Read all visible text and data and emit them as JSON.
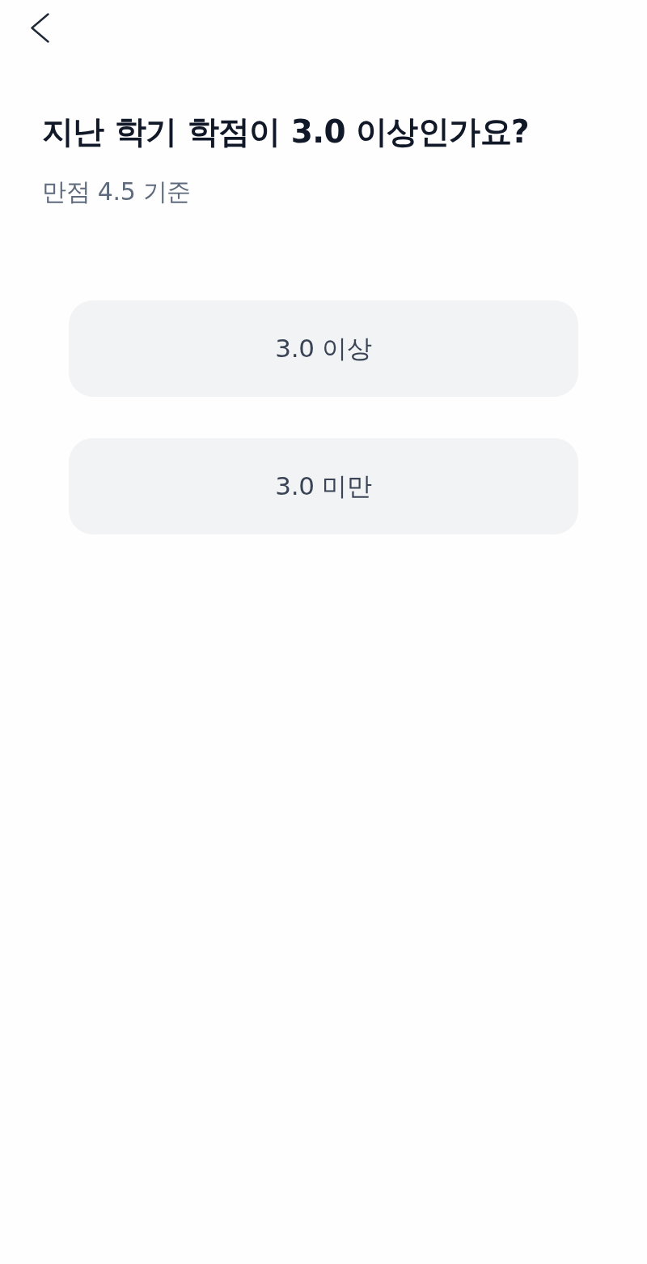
{
  "question": {
    "title": "지난 학기 학점이 3.0 이상인가요?",
    "subtitle": "만점 4.5 기준"
  },
  "options": [
    {
      "label": "3.0 이상",
      "selected": false
    },
    {
      "label": "3.0 미만",
      "selected": false
    }
  ]
}
